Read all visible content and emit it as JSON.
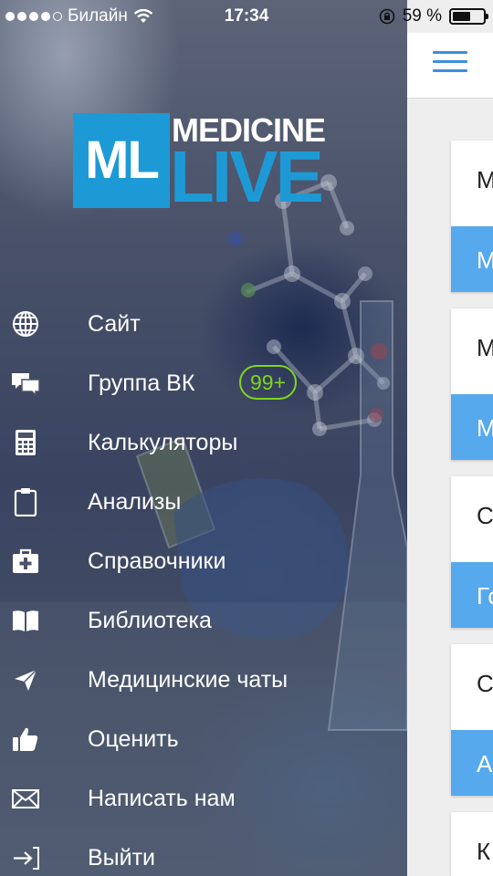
{
  "status_bar": {
    "carrier": "Билайн",
    "time": "17:34",
    "battery_percent": "59 %",
    "battery_level": 0.59,
    "icons": [
      "signal-dots-icon",
      "wifi-icon",
      "orientation-lock-icon",
      "battery-icon"
    ]
  },
  "logo": {
    "box_text": "ML",
    "word_top": "MEDICINE",
    "word_bottom": "LIVE",
    "brand_color": "#1d9ad6"
  },
  "menu": {
    "items": [
      {
        "label": "Сайт",
        "icon": "globe-icon"
      },
      {
        "label": "Группа ВК",
        "icon": "chat-bubbles-icon",
        "badge": "99+"
      },
      {
        "label": "Калькуляторы",
        "icon": "calculator-icon"
      },
      {
        "label": "Анализы",
        "icon": "clipboard-icon"
      },
      {
        "label": "Справочники",
        "icon": "first-aid-kit-icon"
      },
      {
        "label": "Библиотека",
        "icon": "open-book-icon"
      },
      {
        "label": "Медицинские чаты",
        "icon": "paper-plane-icon"
      },
      {
        "label": "Оценить",
        "icon": "thumbs-up-icon"
      },
      {
        "label": "Написать нам",
        "icon": "envelope-icon"
      },
      {
        "label": "Выйти",
        "icon": "logout-icon"
      }
    ],
    "badge_color": "#7fd61e"
  },
  "content": {
    "accent": "#56a9ec",
    "cards": [
      {
        "title": "М",
        "button": "М"
      },
      {
        "title": "М",
        "button": "М"
      },
      {
        "title": "С",
        "button": "Го"
      },
      {
        "title": "С",
        "button": "А"
      },
      {
        "title": "К"
      }
    ]
  }
}
